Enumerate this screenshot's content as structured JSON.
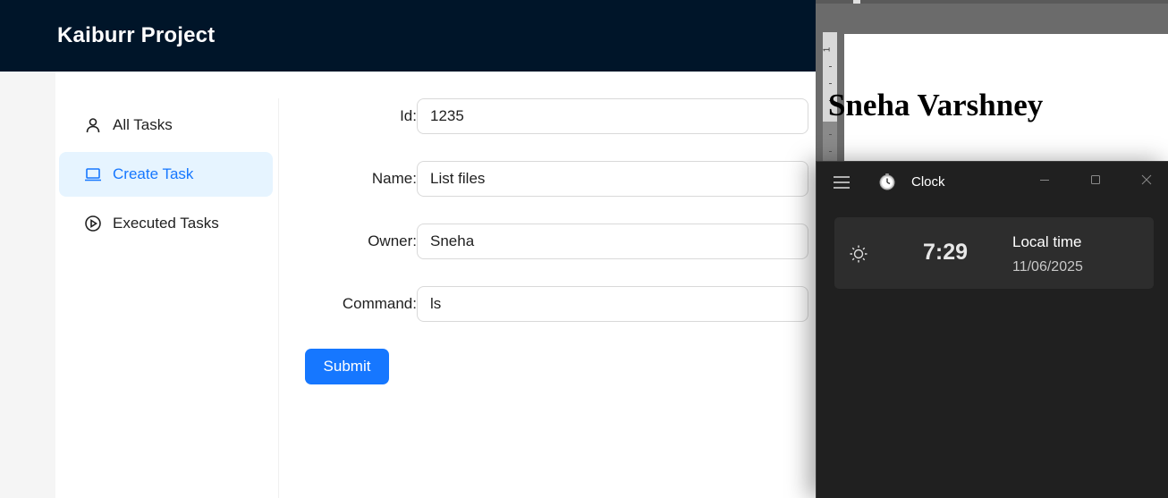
{
  "app": {
    "title": "Kaiburr Project",
    "menu": [
      {
        "label": "All Tasks",
        "icon": "user-icon",
        "selected": false
      },
      {
        "label": "Create Task",
        "icon": "laptop-icon",
        "selected": true
      },
      {
        "label": "Executed Tasks",
        "icon": "play-circle-icon",
        "selected": false
      }
    ],
    "form": {
      "fields": [
        {
          "label": "Id",
          "value": "1235"
        },
        {
          "label": "Name",
          "value": "List files"
        },
        {
          "label": "Owner",
          "value": "Sneha"
        },
        {
          "label": "Command",
          "value": "ls"
        }
      ],
      "submit_label": "Submit"
    },
    "colors": {
      "header": "#001529",
      "accent": "#1677ff",
      "selected_bg": "#e6f4ff"
    }
  },
  "word_doc": {
    "ruler_number": "1",
    "heading": "Sneha Varshney"
  },
  "clock_app": {
    "title": "Clock",
    "time": "7:29",
    "time_label": "Local time",
    "date": "11/06/2025",
    "icons": [
      "hamburger-menu-icon",
      "clock-app-icon",
      "minimize-icon",
      "maximize-icon",
      "close-icon",
      "sun-icon"
    ]
  }
}
